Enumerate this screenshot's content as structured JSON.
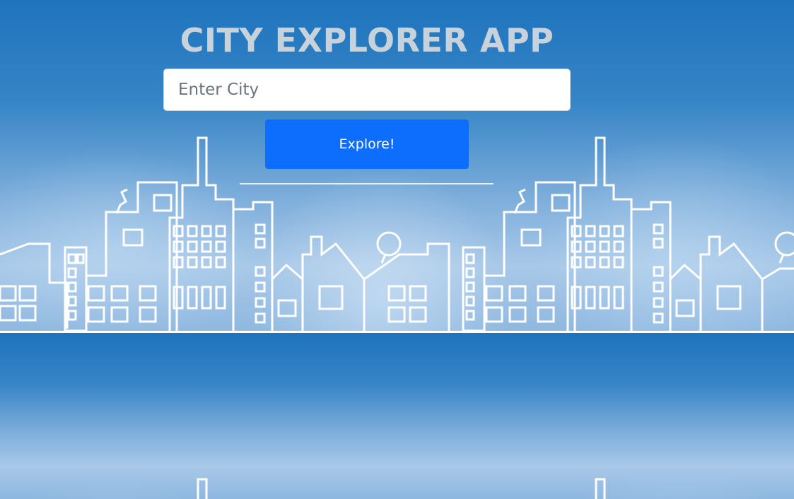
{
  "app": {
    "title": "CITY EXPLORER APP"
  },
  "search": {
    "placeholder": "Enter City",
    "value": ""
  },
  "actions": {
    "explore_label": "Explore!"
  },
  "colors": {
    "background": "#1f74bd",
    "title": "#c8d2da",
    "button": "#0d6efd",
    "button_text": "#ffffff",
    "skyline_stroke": "#ffffff"
  }
}
